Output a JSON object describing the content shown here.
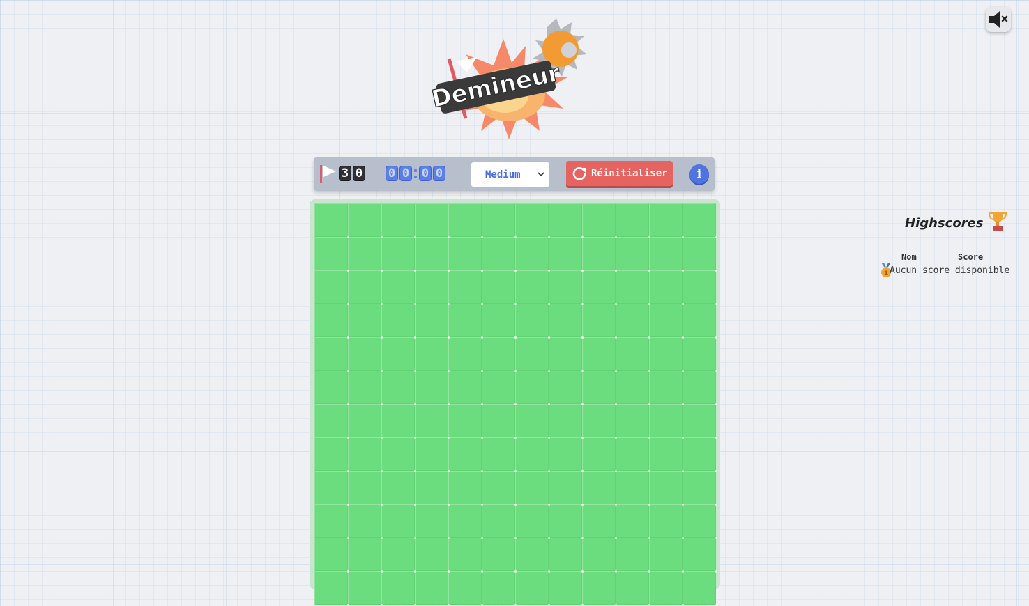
{
  "header": {
    "logo_text": "Demineur",
    "mute_icon": "speaker-muted-icon"
  },
  "toolbar": {
    "flag_icon": "flag-icon",
    "flags_remaining": [
      "3",
      "0"
    ],
    "timer_digits": [
      "0",
      "0",
      "0",
      "0"
    ],
    "difficulty": {
      "selected": "Medium",
      "icon": "chevron-down-icon"
    },
    "reset_label": "Réinitialiser",
    "reset_icon": "refresh-icon",
    "info_label": "i"
  },
  "board": {
    "cell_state": "unrevealed",
    "cell_color": "#6cdd7e"
  },
  "highscores": {
    "title": "Highscores",
    "title_icon": "trophy-icon",
    "columns": [
      "Nom",
      "Score"
    ],
    "empty_message": "Aucun score disponible",
    "medal_icon": "medal-icon"
  },
  "colors": {
    "accent_blue": "#4f74e0",
    "reset_red": "#e56462",
    "board_green": "#6cdd7e",
    "toolbar_gray": "#b7bfcc"
  }
}
